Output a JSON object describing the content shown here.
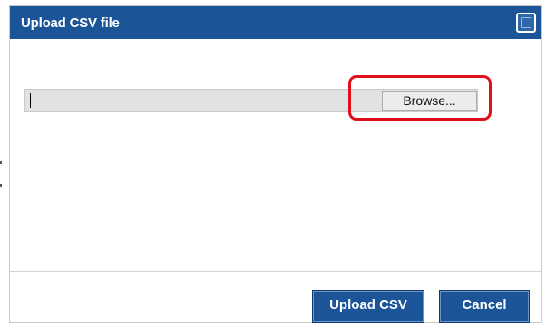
{
  "dialog": {
    "title": "Upload CSV file",
    "close_icon": "close-icon",
    "file_input": {
      "value": "",
      "browse_label": "Browse..."
    },
    "footer": {
      "upload_label": "Upload CSV",
      "cancel_label": "Cancel"
    }
  },
  "colors": {
    "accent": "#1c5597",
    "highlight": "#e0101a"
  }
}
